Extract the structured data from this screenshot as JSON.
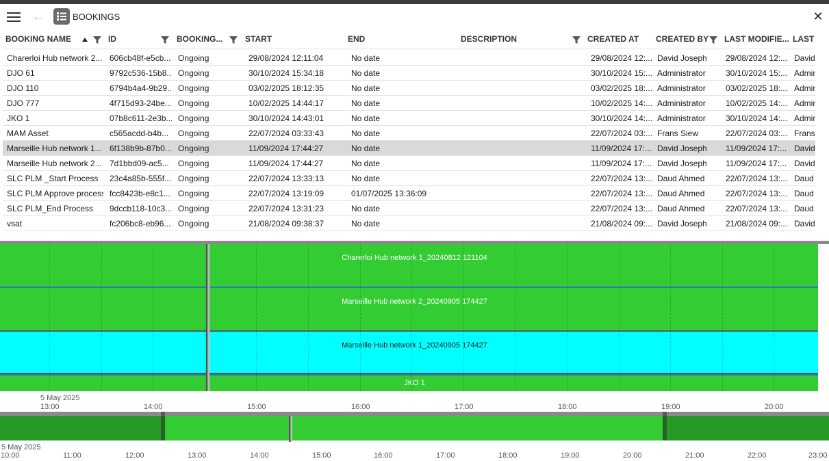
{
  "app": {
    "title": "BOOKINGS"
  },
  "grid": {
    "columns": [
      {
        "key": "name",
        "label": "BOOKING NAME"
      },
      {
        "key": "id",
        "label": "ID"
      },
      {
        "key": "status",
        "label": "BOOKING..."
      },
      {
        "key": "start",
        "label": "START"
      },
      {
        "key": "end",
        "label": "END"
      },
      {
        "key": "description",
        "label": "DESCRIPTION"
      },
      {
        "key": "created_at",
        "label": "CREATED AT"
      },
      {
        "key": "created_by",
        "label": "CREATED BY"
      },
      {
        "key": "last_modified",
        "label": "LAST MODIFIE..."
      },
      {
        "key": "last_modified_by",
        "label": "LAST M"
      }
    ],
    "rows": [
      {
        "name": "Charerloi Hub network 2...",
        "id": "606cb48f-e5cb...",
        "status": "Ongoing",
        "start": "29/08/2024 12:11:04",
        "end": "No date",
        "description": "",
        "created_at": "29/08/2024 12:...",
        "created_by": "David Joseph",
        "last_modified": "29/08/2024 12:...",
        "last_modified_by": "David"
      },
      {
        "name": "DJO 61",
        "id": "9792c536-15b8...",
        "status": "Ongoing",
        "start": "30/10/2024 15:34:18",
        "end": "No date",
        "description": "",
        "created_at": "30/10/2024 15:...",
        "created_by": "Administrator",
        "last_modified": "30/10/2024 15:...",
        "last_modified_by": "Admin"
      },
      {
        "name": "DJO 110",
        "id": "6794b4a4-9b29...",
        "status": "Ongoing",
        "start": "03/02/2025 18:12:35",
        "end": "No date",
        "description": "",
        "created_at": "03/02/2025 18:...",
        "created_by": "Administrator",
        "last_modified": "03/02/2025 18:...",
        "last_modified_by": "Admin"
      },
      {
        "name": "DJO 777",
        "id": "4f715d93-24be...",
        "status": "Ongoing",
        "start": "10/02/2025 14:44:17",
        "end": "No date",
        "description": "",
        "created_at": "10/02/2025 14:...",
        "created_by": "Administrator",
        "last_modified": "10/02/2025 14:...",
        "last_modified_by": "Admin"
      },
      {
        "name": "JKO 1",
        "id": "07b8c611-2e3b...",
        "status": "Ongoing",
        "start": "30/10/2024 14:43:01",
        "end": "No date",
        "description": "",
        "created_at": "30/10/2024 14:...",
        "created_by": "Administrator",
        "last_modified": "30/10/2024 14:...",
        "last_modified_by": "Admin"
      },
      {
        "name": "MAM Asset",
        "id": "c565acdd-b4b...",
        "status": "Ongoing",
        "start": "22/07/2024 03:33:43",
        "end": "No date",
        "description": "",
        "created_at": "22/07/2024 03:...",
        "created_by": "Frans Siew",
        "last_modified": "22/07/2024 03:...",
        "last_modified_by": "Frans"
      },
      {
        "name": "Marseille Hub network 1...",
        "id": "6f138b9b-87b0...",
        "status": "Ongoing",
        "start": "11/09/2024 17:44:27",
        "end": "No date",
        "description": "",
        "created_at": "11/09/2024 17:...",
        "created_by": "David Joseph",
        "last_modified": "11/09/2024 17:...",
        "last_modified_by": "David"
      },
      {
        "name": "Marseille Hub network 2...",
        "id": "7d1bbd09-ac5...",
        "status": "Ongoing",
        "start": "11/09/2024 17:44:27",
        "end": "No date",
        "description": "",
        "created_at": "11/09/2024 17:...",
        "created_by": "David Joseph",
        "last_modified": "11/09/2024 17:...",
        "last_modified_by": "David"
      },
      {
        "name": "SLC PLM _Start Process",
        "id": "23c4a85b-555f...",
        "status": "Ongoing",
        "start": "22/07/2024 13:33:13",
        "end": "No date",
        "description": "",
        "created_at": "22/07/2024 13:...",
        "created_by": "Daud Ahmed",
        "last_modified": "22/07/2024 13:...",
        "last_modified_by": "Daud"
      },
      {
        "name": "SLC PLM Approve process",
        "id": "fcc8423b-e8c1...",
        "status": "Ongoing",
        "start": "22/07/2024 13:19:09",
        "end": "01/07/2025 13:36:09",
        "description": "",
        "created_at": "22/07/2024 13:...",
        "created_by": "Daud Ahmed",
        "last_modified": "22/07/2024 13:...",
        "last_modified_by": "Daud"
      },
      {
        "name": "SLC PLM_End Process",
        "id": "9dccb118-10c3...",
        "status": "Ongoing",
        "start": "22/07/2024 13:31:23",
        "end": "No date",
        "description": "",
        "created_at": "22/07/2024 13:...",
        "created_by": "Daud Ahmed",
        "last_modified": "22/07/2024 13:...",
        "last_modified_by": "Daud"
      },
      {
        "name": "vsat",
        "id": "fc206bc8-eb96...",
        "status": "Ongoing",
        "start": "21/08/2024 09:38:37",
        "end": "No date",
        "description": "",
        "created_at": "21/08/2024 09:...",
        "created_by": "David Joseph",
        "last_modified": "21/08/2024 09:...",
        "last_modified_by": "David"
      }
    ],
    "selected_row": 6
  },
  "timeline": {
    "date_label": "5 May 2025",
    "ticks": [
      "13:00",
      "14:00",
      "15:00",
      "16:00",
      "17:00",
      "18:00",
      "19:00",
      "20:00"
    ],
    "bands": [
      {
        "label": "Charerloi Hub network 1_20240812 121104",
        "color": "#33cc33",
        "selected": false
      },
      {
        "label": "Marseille Hub network 2_20240905 174427",
        "color": "#33cc33",
        "selected": false
      },
      {
        "label": "Marseille Hub network 1_20240905 174427",
        "color": "#00ffff",
        "selected": true
      },
      {
        "label": "JKO 1",
        "color": "#33cc33",
        "selected": false
      }
    ]
  },
  "navigator": {
    "date_label": "5 May 2025",
    "ticks": [
      "10:00",
      "11:00",
      "12:00",
      "13:00",
      "14:00",
      "15:00",
      "16:00",
      "17:00",
      "18:00",
      "19:00",
      "20:00",
      "21:00",
      "22:00",
      "23:00"
    ]
  },
  "colors": {
    "booking_green": "#33cc33",
    "selected_cyan": "#00ffff",
    "separator_blue": "#2b7bb9"
  },
  "icons": {
    "menu": "hamburger-icon",
    "back": "back-arrow-icon",
    "app": "list-icon",
    "close": "close-icon",
    "filter": "filter-icon"
  }
}
